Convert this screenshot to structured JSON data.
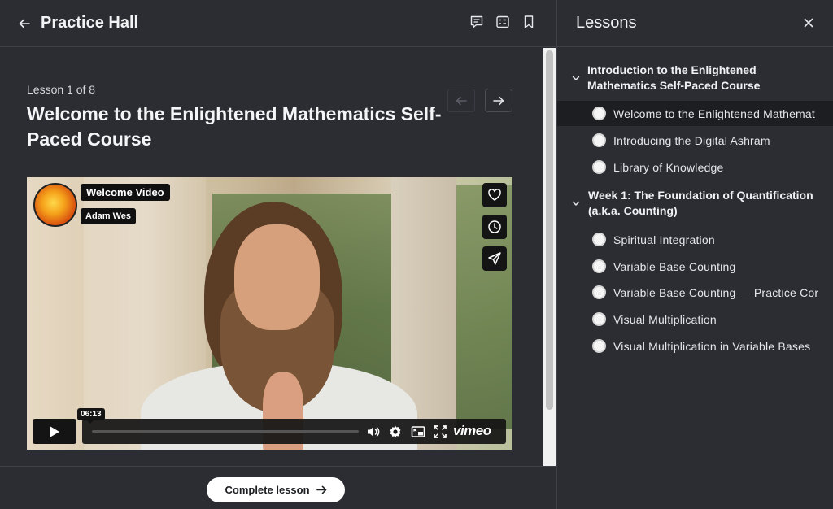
{
  "header": {
    "title": "Practice Hall",
    "icons": [
      "arrow-left-icon",
      "comment-icon",
      "checklist-icon",
      "bookmark-icon"
    ]
  },
  "lesson": {
    "count": "Lesson 1 of 8",
    "title": "Welcome to the Enlightened Mathematics Self-Paced Course"
  },
  "video": {
    "title_tag": "Welcome Video",
    "author_tag": "Adam Wes",
    "timestamp": "06:13",
    "brand": "vimeo",
    "progress": 0.0
  },
  "footer": {
    "complete_label": "Complete lesson"
  },
  "sidebar": {
    "title": "Lessons",
    "sections": [
      {
        "title": "Introduction to the Enlightened Mathematics Self-Paced Course",
        "items": [
          {
            "label": "Welcome to the Enlightened Mathemat",
            "active": true
          },
          {
            "label": "Introducing the Digital Ashram",
            "active": false
          },
          {
            "label": "Library of Knowledge",
            "active": false
          }
        ]
      },
      {
        "title": "Week 1: The Foundation of Quantification (a.k.a. Counting)",
        "items": [
          {
            "label": "Spiritual Integration",
            "active": false
          },
          {
            "label": "Variable Base Counting",
            "active": false
          },
          {
            "label": "Variable Base Counting — Practice Cor",
            "active": false
          },
          {
            "label": "Visual Multiplication",
            "active": false
          },
          {
            "label": "Visual Multiplication in Variable Bases",
            "active": false
          }
        ]
      }
    ]
  },
  "colors": {
    "background": "#2b2d33",
    "active_item": "#1d1e22",
    "button_bg": "#ffffff"
  }
}
